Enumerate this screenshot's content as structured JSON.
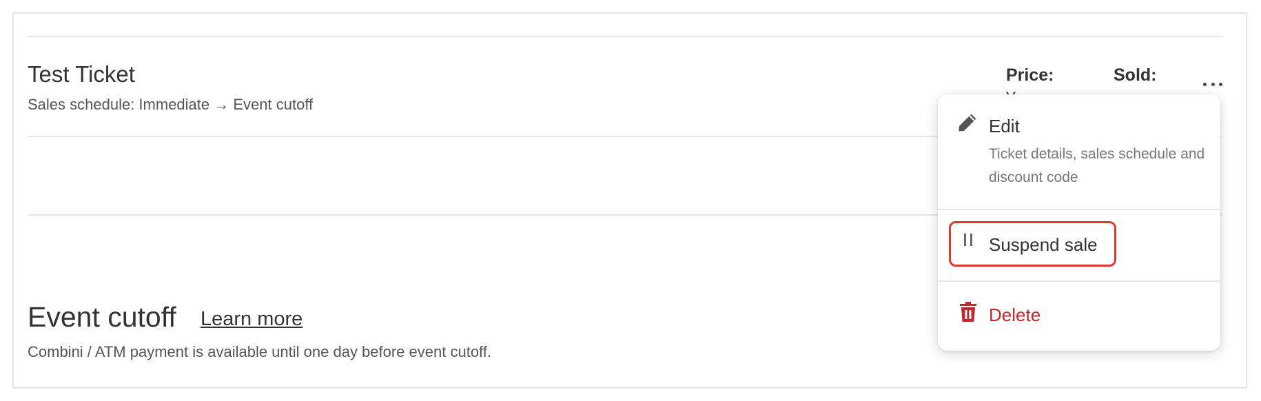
{
  "ticket": {
    "name": "Test Ticket",
    "schedule": "Sales schedule: Immediate → Event cutoff",
    "price_label": "Price:",
    "price_value": "¥",
    "sold_label": "Sold:"
  },
  "event_cutoff": {
    "title": "Event cutoff",
    "learn_more": "Learn more",
    "note": "Combini / ATM payment is available until one day before event cutoff."
  },
  "menu": {
    "edit_label": "Edit",
    "edit_description": "Ticket details, sales schedule and discount code",
    "suspend_label": "Suspend sale",
    "delete_label": "Delete",
    "icons": {
      "edit": "pencil-icon",
      "suspend": "pause-icon",
      "delete": "trash-icon",
      "more": "more-horizontal-icon"
    }
  },
  "colors": {
    "delete": "#c0282d",
    "highlight": "#e0392b",
    "text": "#333333",
    "muted": "#777777"
  }
}
